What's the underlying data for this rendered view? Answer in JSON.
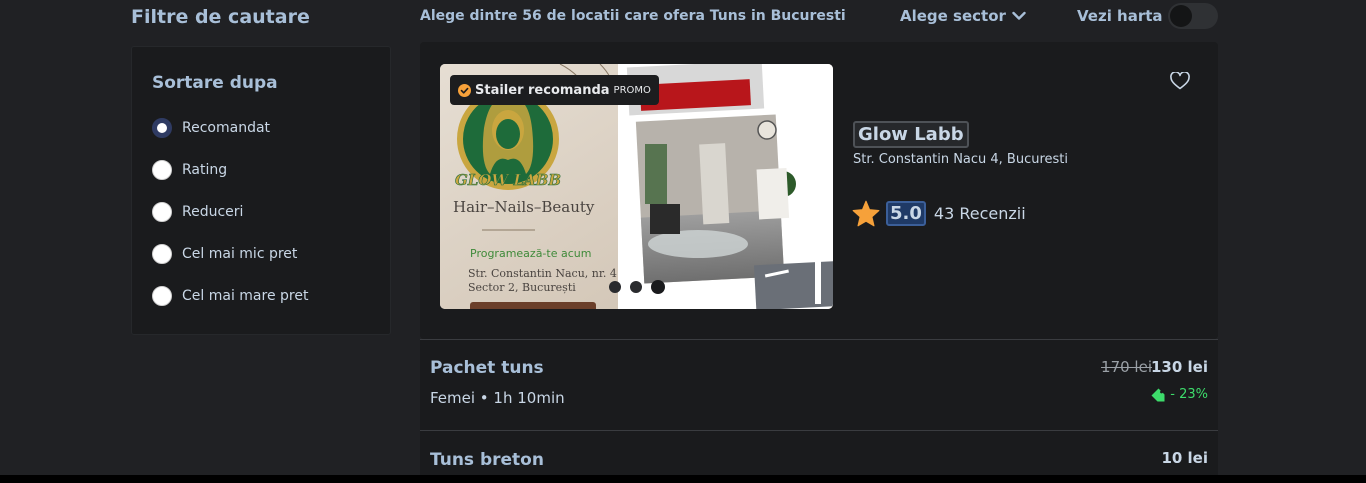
{
  "filters": {
    "title": "Filtre de cautare",
    "sort_title": "Sortare dupa",
    "options": [
      {
        "label": "Recomandat",
        "checked": true
      },
      {
        "label": "Rating",
        "checked": false
      },
      {
        "label": "Reduceri",
        "checked": false
      },
      {
        "label": "Cel mai mic pret",
        "checked": false
      },
      {
        "label": "Cel mai mare pret",
        "checked": false
      }
    ]
  },
  "header": {
    "results_text": "Alege dintre 56 de locatii care ofera Tuns in Bucuresti",
    "sector_label": "Alege sector",
    "map_label": "Vezi harta",
    "map_toggle_on": false
  },
  "card": {
    "promo_label": "Stailer recomanda",
    "promo_tag": "PROMO",
    "carousel_slide_count": 3,
    "carousel_active_index": 2,
    "salon_name": "Glow Labb",
    "address": "Str. Constantin Nacu 4, Bucuresti",
    "rating": "5.0",
    "reviews": "43 Recenzii",
    "image_text": {
      "brand": "GLOW LABB",
      "tagline": "Hair–Nails–Beauty",
      "cta": "Programează-te acum",
      "address_line1": "Str. Constantin Nacu, nr. 4",
      "address_line2": "Sector 2, București"
    }
  },
  "services": [
    {
      "name": "Pachet tuns",
      "meta": "Femei • 1h 10min",
      "old_price": "170 lei",
      "price": "130 lei",
      "discount": "- 23%"
    },
    {
      "name": "Tuns breton",
      "price": "10 lei"
    }
  ],
  "colors": {
    "background": "#202124",
    "panel": "#1a1b1d",
    "heading": "#a8bfd8",
    "star": "#f6a13a",
    "discount": "#3ddc6b",
    "brand_gold": "#c9a640",
    "brand_green": "#1e6b3a"
  },
  "icons": {
    "sector_dropdown": "chevron-down-icon",
    "favorite": "heart-icon",
    "rating": "star-icon",
    "promo": "check-badge-icon",
    "discount": "tag-icon"
  }
}
